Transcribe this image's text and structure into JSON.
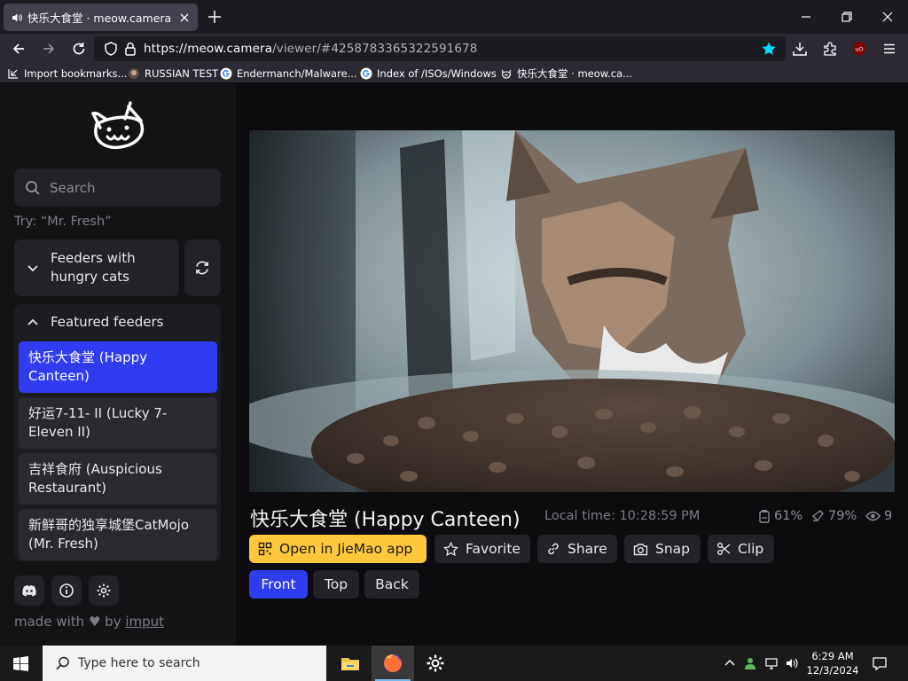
{
  "browser": {
    "tab_title": "快乐大食堂 · meow.camera",
    "url_host": "https://meow.camera",
    "url_path": "/viewer/#4258783365322591678",
    "bookmarks": [
      {
        "label": "Import bookmarks...",
        "icon": "import-icon"
      },
      {
        "label": "RUSSIAN TEST",
        "icon": "globe-icon"
      },
      {
        "label": "Endermanch/Malware...",
        "icon": "google-icon"
      },
      {
        "label": "Index of /ISOs/Windows",
        "icon": "google-icon"
      },
      {
        "label": "快乐大食堂 · meow.ca...",
        "icon": "cat-logo-icon"
      }
    ]
  },
  "sidebar": {
    "search_placeholder": "Search",
    "hint": "Try: “Mr. Fresh”",
    "hungry_label": "Feeders with hungry cats",
    "featured_label": "Featured feeders",
    "feeders": [
      {
        "label": "快乐大食堂 (Happy Canteen)",
        "active": true
      },
      {
        "label": "好运7-11- II (Lucky 7-Eleven II)",
        "active": false
      },
      {
        "label": "吉祥食府 (Auspicious Restaurant)",
        "active": false
      },
      {
        "label": "新鲜哥的独享城堡CatMojo (Mr. Fresh)",
        "active": false
      }
    ],
    "made_with_prefix": "made with",
    "made_with_by": "by",
    "made_with_link": "imput"
  },
  "viewer": {
    "feeder_title": "快乐大食堂 (Happy Canteen)",
    "local_time": "Local time: 10:28:59 PM",
    "stats": {
      "food": "61%",
      "battery": "79%",
      "viewers": "9"
    },
    "actions": {
      "open_app": "Open in JieMao app",
      "favorite": "Favorite",
      "share": "Share",
      "snap": "Snap",
      "clip": "Clip"
    },
    "views": [
      {
        "label": "Front",
        "active": true
      },
      {
        "label": "Top",
        "active": false
      },
      {
        "label": "Back",
        "active": false
      }
    ]
  },
  "taskbar": {
    "search_placeholder": "Type here to search",
    "time": "6:29 AM",
    "date": "12/3/2024"
  },
  "colors": {
    "accent_blue": "#2e3cf2",
    "app_button_yellow": "#ffc83a",
    "bookmark_star": "#00ddff"
  }
}
